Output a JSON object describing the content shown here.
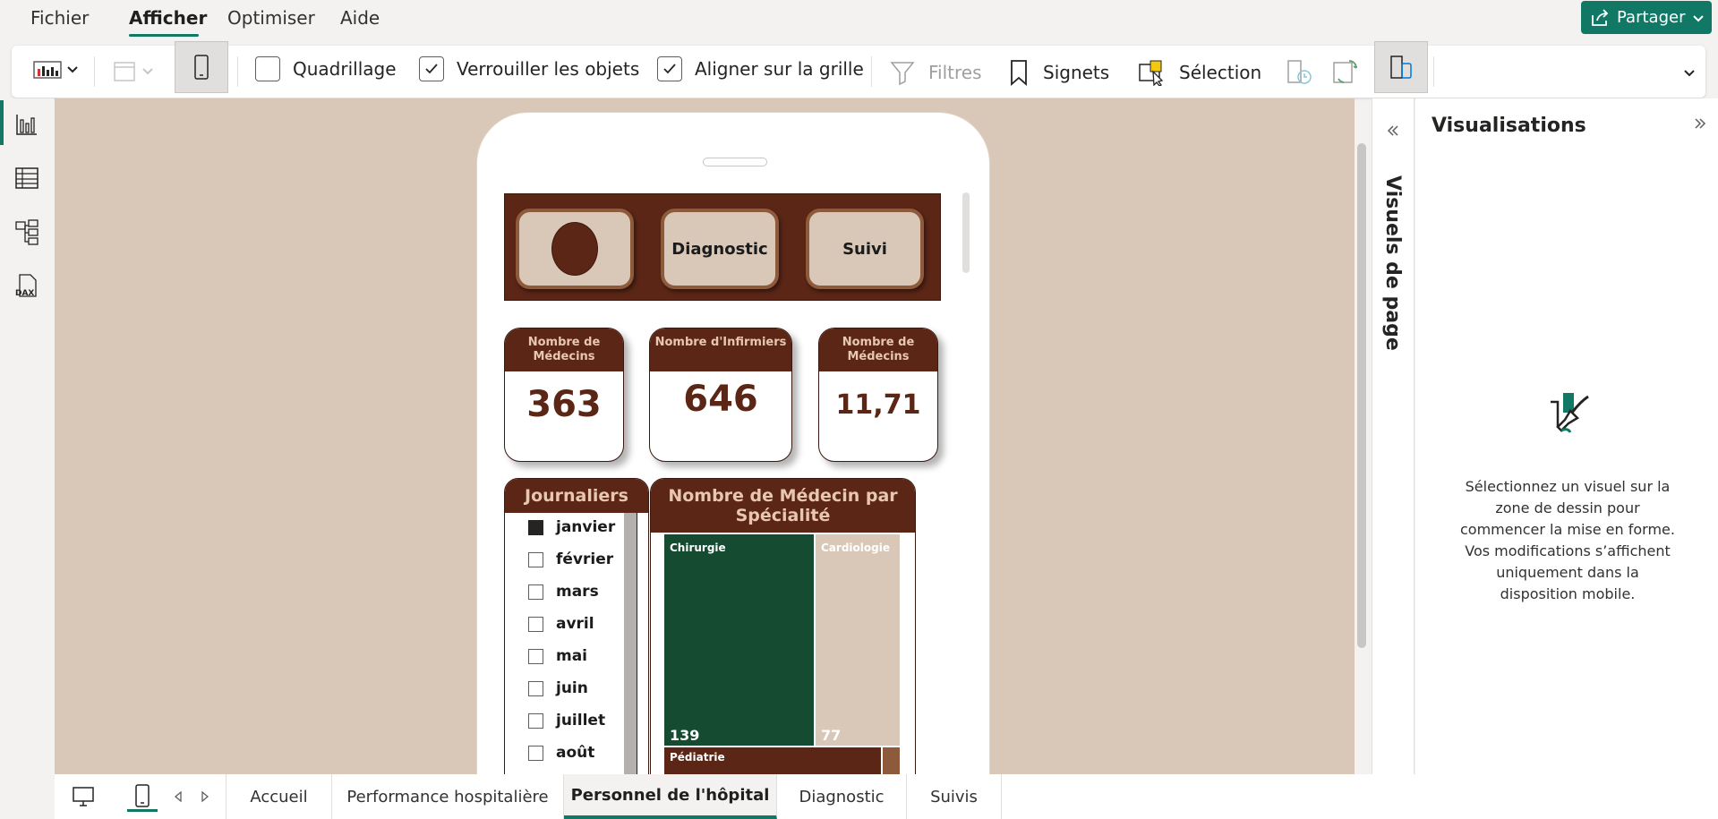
{
  "menu": {
    "items": [
      "Fichier",
      "Afficher",
      "Optimiser",
      "Aide"
    ],
    "share_label": "Partager"
  },
  "ribbon": {
    "gridlines": "Quadrillage",
    "lock_objects": "Verrouiller les objets",
    "snap_grid": "Aligner sur la grille",
    "filters": "Filtres",
    "bookmarks": "Signets",
    "selection": "Sélection",
    "gridlines_checked": false,
    "lock_checked": true,
    "snap_checked": true
  },
  "report": {
    "header_buttons": [
      "Diagnostic",
      "Suivi"
    ],
    "kpis": [
      {
        "label": "Nombre de Médecins",
        "value": "363"
      },
      {
        "label": "Nombre d'Infirmiers",
        "value": "646"
      },
      {
        "label": "Nombre de Médecins",
        "value": "11,71"
      }
    ],
    "slicer": {
      "title": "Journaliers",
      "items": [
        "janvier",
        "février",
        "mars",
        "avril",
        "mai",
        "juin",
        "juillet",
        "août"
      ],
      "selected": "janvier"
    },
    "treemap": {
      "title": "Nombre de Médecin par Spécialité",
      "categories": [
        {
          "name": "Chirurgie",
          "value": "139",
          "color": "#144b31"
        },
        {
          "name": "Cardiologie",
          "value": "77",
          "color": "#d9c8b8"
        },
        {
          "name": "Pédiatrie",
          "value": "",
          "color": "#5b2616"
        }
      ]
    }
  },
  "panes": {
    "page_visuals": "Visuels de page",
    "visualizations_title": "Visualisations",
    "visualizations_message": "Sélectionnez un visuel sur la zone de dessin pour commencer la mise en forme. Vos modifications s’affichent uniquement dans la disposition mobile."
  },
  "tabs": {
    "items": [
      "Accueil",
      "Performance hospitalière",
      "Personnel de l'hôpital",
      "Diagnostic",
      "Suivis"
    ],
    "active": "Personnel de l'hôpital"
  },
  "colors": {
    "accent": "#117865",
    "brown": "#5b2616",
    "beige": "#d9c8b8",
    "green": "#144b31"
  }
}
